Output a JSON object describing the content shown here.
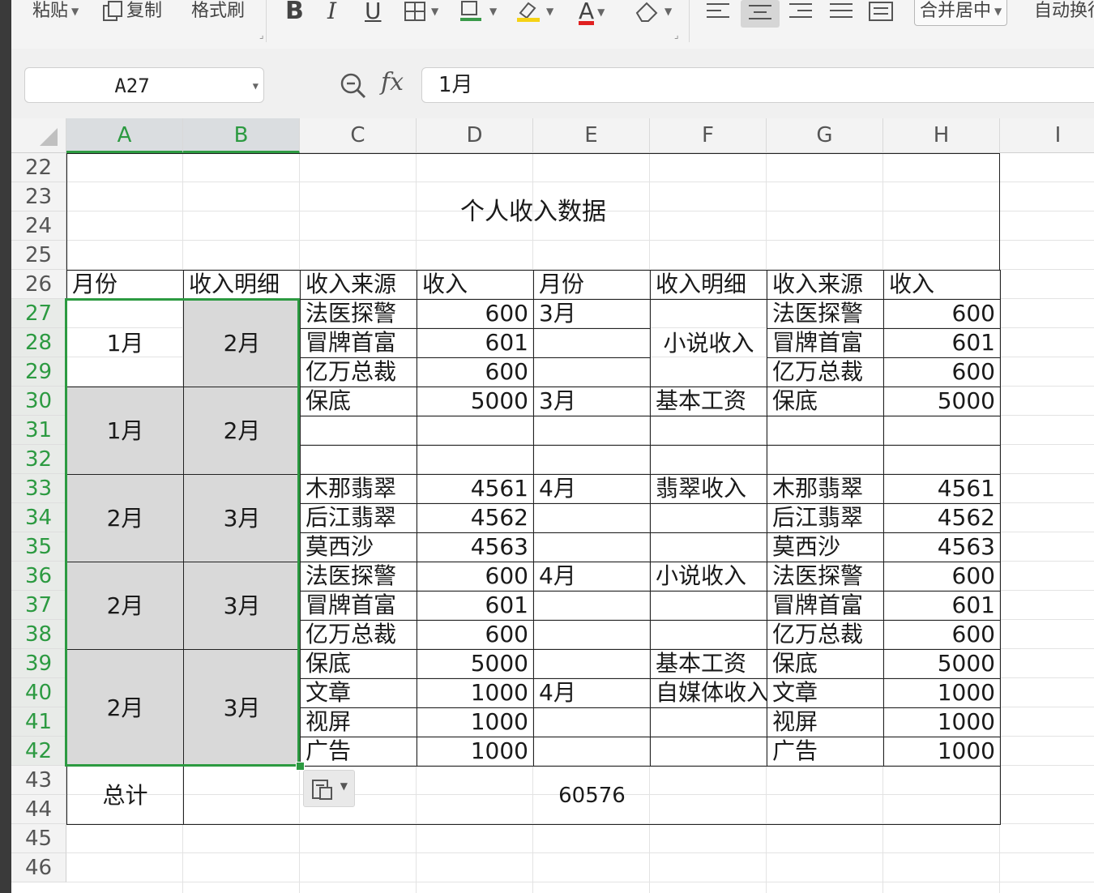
{
  "toolbar": {
    "paste": "粘贴",
    "copy": "复制",
    "format_painter": "格式刷",
    "bold": "B",
    "italic": "I",
    "underline": "U",
    "font_color_glyph": "A",
    "merge_center": "合并居中",
    "auto_wrap": "自动换行",
    "colors": {
      "highlight": "#f5d214",
      "font_red": "#e02020"
    }
  },
  "formula_bar": {
    "name_box": "A27",
    "fx": "fx",
    "formula": "1月"
  },
  "columns": [
    "A",
    "B",
    "C",
    "D",
    "E",
    "F",
    "G",
    "H",
    "I"
  ],
  "rows": [
    "22",
    "23",
    "24",
    "25",
    "26",
    "27",
    "28",
    "29",
    "30",
    "31",
    "32",
    "33",
    "34",
    "35",
    "36",
    "37",
    "38",
    "39",
    "40",
    "41",
    "42",
    "43",
    "44",
    "45",
    "46"
  ],
  "sheet": {
    "title": "个人收入数据",
    "headers": [
      "月份",
      "收入明细",
      "收入来源",
      "收入",
      "月份",
      "收入明细",
      "收入来源",
      "收入"
    ],
    "a_merged": [
      "1月",
      "1月",
      "2月",
      "2月",
      "2月"
    ],
    "b_merged": [
      "2月",
      "2月",
      "3月",
      "3月",
      "3月"
    ],
    "c_values": [
      "法医探警",
      "冒牌首富",
      "亿万总裁",
      "保底",
      "",
      "",
      "木那翡翠",
      "后江翡翠",
      "莫西沙",
      "法医探警",
      "冒牌首富",
      "亿万总裁",
      "保底",
      "文章",
      "视屏",
      "广告"
    ],
    "d_values": [
      "600",
      "601",
      "600",
      "5000",
      "",
      "",
      "4561",
      "4562",
      "4563",
      "600",
      "601",
      "600",
      "5000",
      "1000",
      "1000",
      "1000"
    ],
    "e_values": [
      "3月",
      "",
      "",
      "3月",
      "",
      "",
      "4月",
      "",
      "",
      "4月",
      "",
      "",
      "",
      "4月",
      "",
      ""
    ],
    "f_merged_novel": "小说收入",
    "f_values": {
      "30": "基本工资",
      "33": "翡翠收入",
      "36": "小说收入",
      "39": "基本工资",
      "40": "自媒体收入"
    },
    "g_values": [
      "法医探警",
      "冒牌首富",
      "亿万总裁",
      "保底",
      "",
      "",
      "木那翡翠",
      "后江翡翠",
      "莫西沙",
      "法医探警",
      "冒牌首富",
      "亿万总裁",
      "保底",
      "文章",
      "视屏",
      "广告"
    ],
    "h_values": [
      "600",
      "601",
      "600",
      "5000",
      "",
      "",
      "4561",
      "4562",
      "4563",
      "600",
      "601",
      "600",
      "5000",
      "1000",
      "1000",
      "1000"
    ],
    "total_label": "总计",
    "total_value": "60576"
  },
  "selection": {
    "color": "#2c9a41",
    "range": "A27:B42"
  }
}
